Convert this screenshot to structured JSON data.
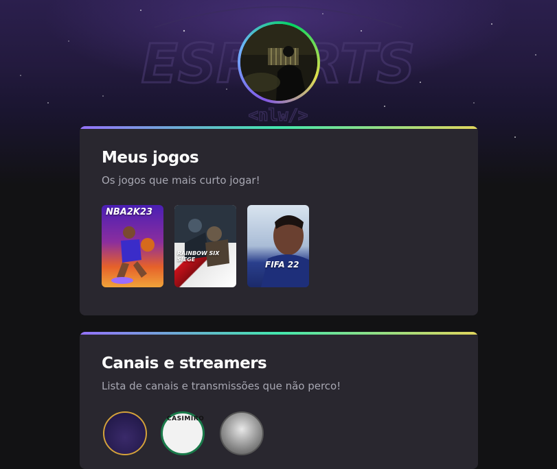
{
  "profile": {
    "avatar_icon": "profile-photo"
  },
  "background": {
    "logo_text": "ESPORTS",
    "logo_subtext": "<nlw/>"
  },
  "games_section": {
    "title": "Meus jogos",
    "subtitle": "Os jogos que mais curto jogar!",
    "games": [
      {
        "name": "NBA 2K23",
        "label": "NBA2K23"
      },
      {
        "name": "Rainbow Six Siege",
        "label": "RAINBOW SIX SIEGE"
      },
      {
        "name": "FIFA 22",
        "label": "FIFA 22"
      }
    ]
  },
  "channels_section": {
    "title": "Canais e streamers",
    "subtitle": "Lista de canais e transmissões que não perco!",
    "channels": [
      {
        "name": "streamer-1"
      },
      {
        "name": "Casimiro",
        "label": "CASIMIRO"
      },
      {
        "name": "streamer-3"
      }
    ]
  },
  "colors": {
    "accent_gradient": [
      "#9572fc",
      "#43e7ad",
      "#e1d55d"
    ],
    "card_bg": "#29272f",
    "page_bg": "#121214"
  }
}
